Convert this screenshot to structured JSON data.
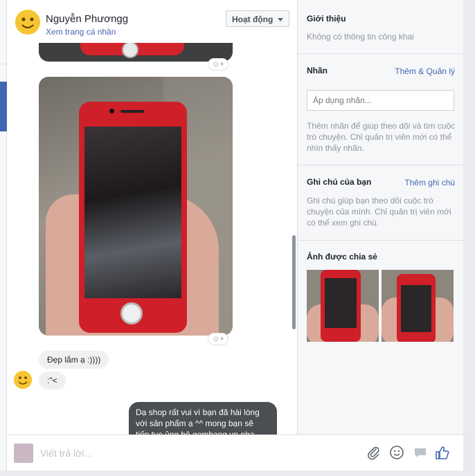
{
  "conversation": {
    "user_name": "Nguyễn Phươngg",
    "profile_link": "Xem trang cá nhân",
    "status_button": "Hoạt động",
    "react_glyph": "☺+"
  },
  "messages": {
    "incoming_1": "Đẹp lắm ạ :))))",
    "incoming_2": ":\"<",
    "outgoing_lines": [
      "Dạ shop rất vui vì bạn đã hài lòng",
      "với sản phẩm ạ ^^ mong bạn sẽ",
      "tiếp tục ủng hộ gembang vn nha"
    ]
  },
  "composer": {
    "placeholder": "Viết trả lời...",
    "icons": [
      "paperclip-icon",
      "emoji-icon",
      "sticker-icon",
      "like-icon"
    ]
  },
  "sidebar": {
    "intro_title": "Giới thiệu",
    "intro_text": "Không có thông tin công khai",
    "labels_title": "Nhãn",
    "labels_link": "Thêm & Quản lý",
    "labels_placeholder": "Áp dụng nhãn...",
    "labels_text": "Thêm nhãn để giúp theo dõi và tìm cuộc trò chuyện. Chỉ quản trị viên mới có thể nhìn thấy nhãn.",
    "notes_title": "Ghi chú của bạn",
    "notes_link": "Thêm ghi chú",
    "notes_text": "Ghi chú giúp bạn theo dõi cuộc trò chuyện của mình. Chỉ quản trị viên mới có thể xem ghi chú.",
    "photos_title": "Ảnh được chia sẻ"
  },
  "colors": {
    "link_blue": "#4267b2",
    "outgoing_bubble": "#4b4e52",
    "incoming_bubble": "#f1f0f0",
    "phone_red": "#cf1f28"
  }
}
